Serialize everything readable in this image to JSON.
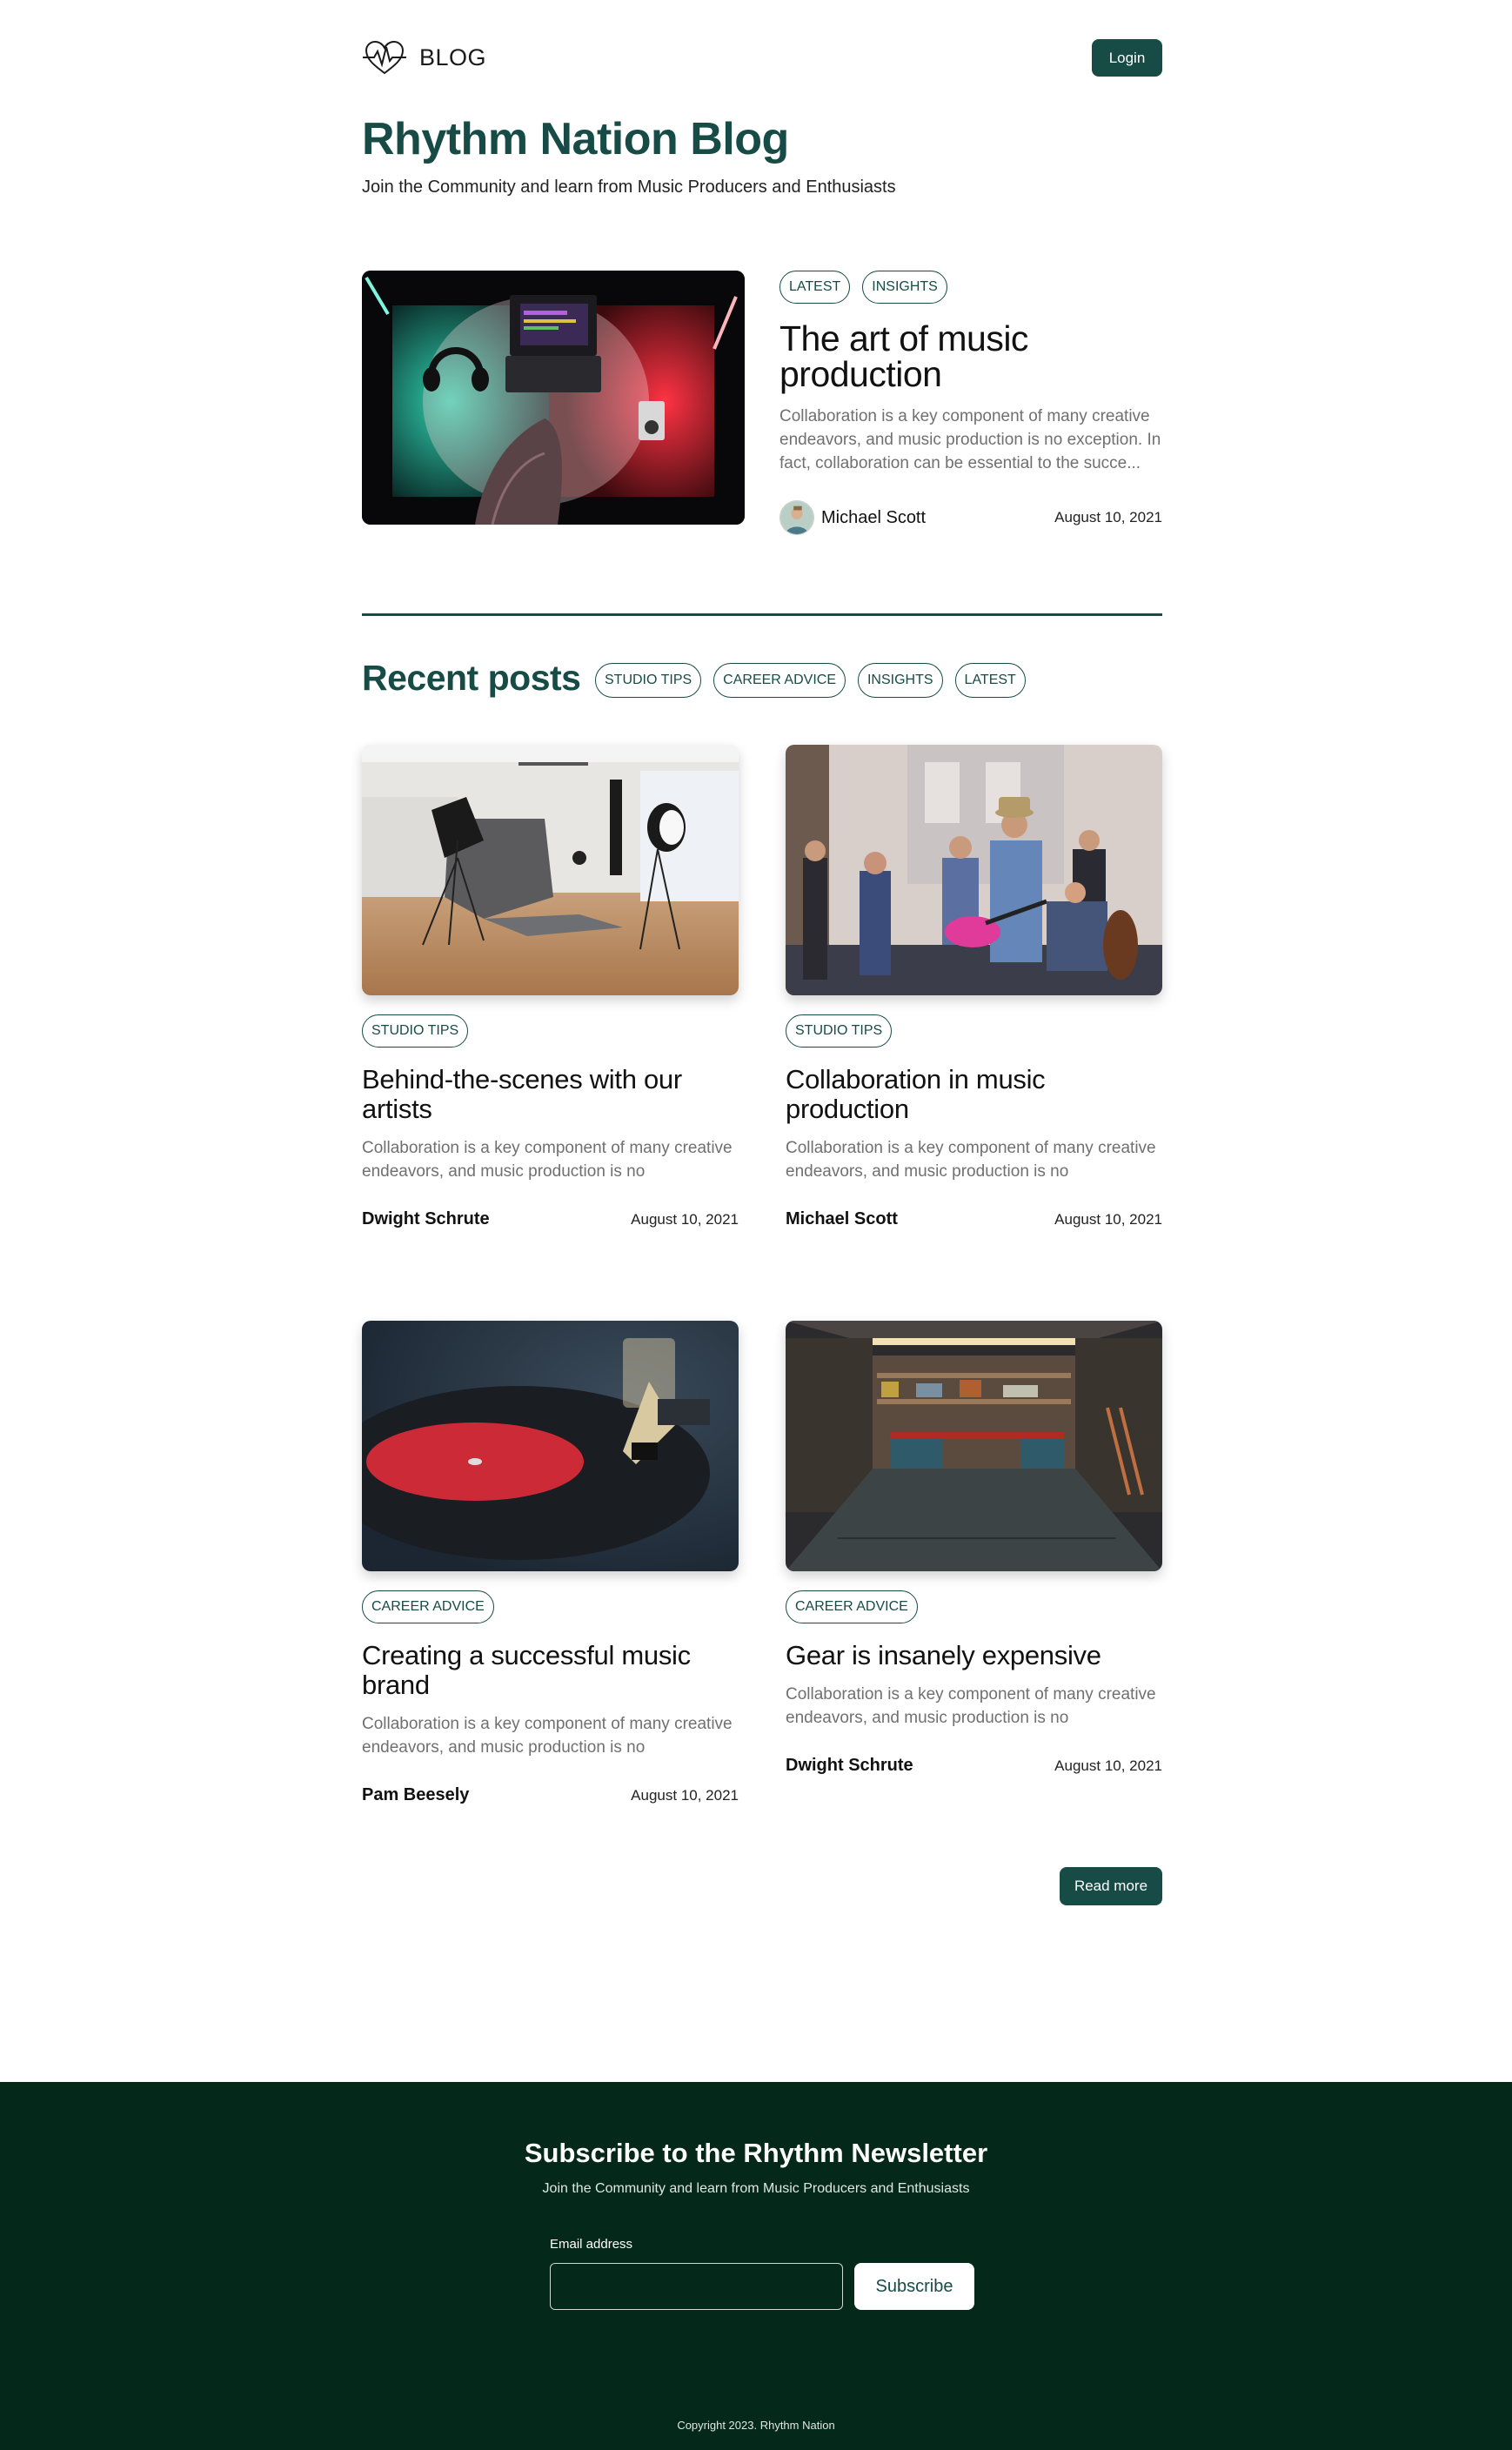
{
  "header": {
    "logo_text": "BLOG",
    "login_label": "Login"
  },
  "hero": {
    "title": "Rhythm Nation Blog",
    "subtitle": "Join the Community and learn from Music Producers and Enthusiasts"
  },
  "featured": {
    "tags": [
      "LATEST",
      "INSIGHTS"
    ],
    "title": "The art of music production",
    "excerpt": "Collaboration is a key component of many creative endeavors, and music production is no exception. In fact, collaboration can be essential to the succe...",
    "author": "Michael Scott",
    "date": "August 10, 2021"
  },
  "recent": {
    "title": "Recent posts",
    "filters": [
      "STUDIO TIPS",
      "CAREER ADVICE",
      "INSIGHTS",
      "LATEST"
    ],
    "posts": [
      {
        "tag": "STUDIO TIPS",
        "title": "Behind-the-scenes with our artists",
        "excerpt": "Collaboration is a key component of many creative endeavors, and music production is no exception....",
        "author": "Dwight Schrute",
        "date": "August 10, 2021",
        "image": "photo-studio"
      },
      {
        "tag": "STUDIO TIPS",
        "title": "Collaboration in music production",
        "excerpt": "Collaboration is a key component of many creative endeavors, and music production is no exception....",
        "author": "Michael Scott",
        "date": "August 10, 2021",
        "image": "street-band"
      },
      {
        "tag": "CAREER ADVICE",
        "title": "Creating a successful music brand",
        "excerpt": "Collaboration is a key component of many creative endeavors, and music production is no exception....",
        "author": "Pam Beesely",
        "date": "August 10, 2021",
        "image": "vinyl-record"
      },
      {
        "tag": "CAREER ADVICE",
        "title": "Gear is insanely expensive",
        "excerpt": "Collaboration is a key component of many creative endeavors, and music production is no exception....",
        "author": "Dwight Schrute",
        "date": "August 10, 2021",
        "image": "garage-workshop"
      }
    ],
    "read_more_label": "Read more"
  },
  "newsletter": {
    "title": "Subscribe to the Rhythm Newsletter",
    "subtitle": "Join the Community and learn from Music Producers and Enthusiasts",
    "email_label": "Email address",
    "email_value": "",
    "subscribe_label": "Subscribe"
  },
  "footer": {
    "copyright": "Copyright 2023. Rhythm Nation"
  },
  "colors": {
    "brand": "#174b45",
    "footer_bg": "#04291a",
    "muted_text": "#707070"
  },
  "icons": {
    "logo": "heart-pulse-icon"
  }
}
